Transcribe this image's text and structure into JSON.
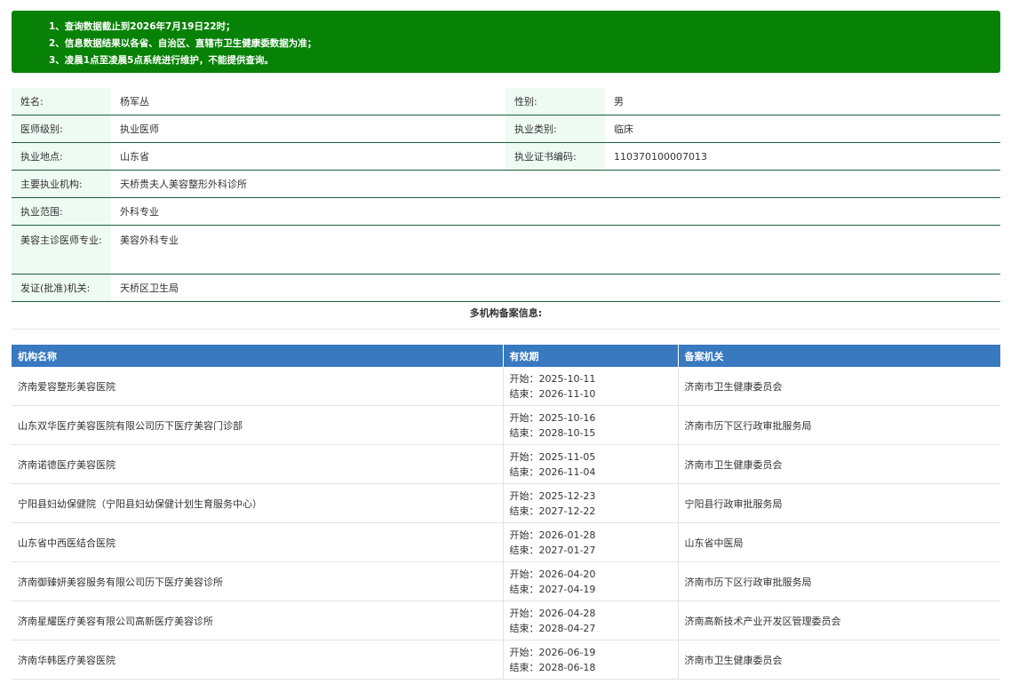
{
  "notice": [
    "1、查询数据截止到2026年7月19日22时；",
    "2、信息数据结果以各省、自治区、直辖市卫生健康委数据为准；",
    "3、凌晨1点至凌晨5点系统进行维护，不能提供查询。"
  ],
  "info": {
    "name_label": "姓名:",
    "name": "杨军丛",
    "gender_label": "性别:",
    "gender": "男",
    "level_label": "医师级别:",
    "level": "执业医师",
    "category_label": "执业类别:",
    "category": "临床",
    "location_label": "执业地点:",
    "location": "山东省",
    "cert_label": "执业证书编码:",
    "cert": "110370100007013",
    "org_label": "主要执业机构:",
    "org": "天桥贵夫人美容整形外科诊所",
    "scope_label": "执业范围:",
    "scope": "外科专业",
    "cosmetic_label": "美容主诊医师专业:",
    "cosmetic": "美容外科专业",
    "issuer_label": "发证(批准)机关:",
    "issuer": "天桥区卫生局"
  },
  "multi_title": "多机构备案信息:",
  "table": {
    "headers": [
      "机构名称",
      "有效期",
      "备案机关"
    ],
    "rows": [
      {
        "name": "济南爱容整形美容医院",
        "start": "开始：2025-10-11",
        "end": "结束：2026-11-10",
        "authority": "济南市卫生健康委员会"
      },
      {
        "name": "山东双华医疗美容医院有限公司历下医疗美容门诊部",
        "start": "开始：2025-10-16",
        "end": "结束：2028-10-15",
        "authority": "济南市历下区行政审批服务局"
      },
      {
        "name": "济南诺德医疗美容医院",
        "start": "开始：2025-11-05",
        "end": "结束：2026-11-04",
        "authority": "济南市卫生健康委员会"
      },
      {
        "name": "宁阳县妇幼保健院（宁阳县妇幼保健计划生育服务中心）",
        "start": "开始：2025-12-23",
        "end": "结束：2027-12-22",
        "authority": "宁阳县行政审批服务局"
      },
      {
        "name": "山东省中西医结合医院",
        "start": "开始：2026-01-28",
        "end": "结束：2027-01-27",
        "authority": "山东省中医局"
      },
      {
        "name": "济南御臻妍美容服务有限公司历下医疗美容诊所",
        "start": "开始：2026-04-20",
        "end": "结束：2027-04-19",
        "authority": "济南市历下区行政审批服务局"
      },
      {
        "name": "济南星耀医疗美容有限公司高新医疗美容诊所",
        "start": "开始：2026-04-28",
        "end": "结束：2028-04-27",
        "authority": "济南高新技术产业开发区管理委员会"
      },
      {
        "name": "济南华韩医疗美容医院",
        "start": "开始：2026-06-19",
        "end": "结束：2028-06-18",
        "authority": "济南市卫生健康委员会"
      }
    ]
  },
  "colors": {
    "notice_bg": "#078207",
    "header_bg": "#3879c0",
    "label_bg": "#eefbf2",
    "row_border": "#1e5f3c"
  }
}
